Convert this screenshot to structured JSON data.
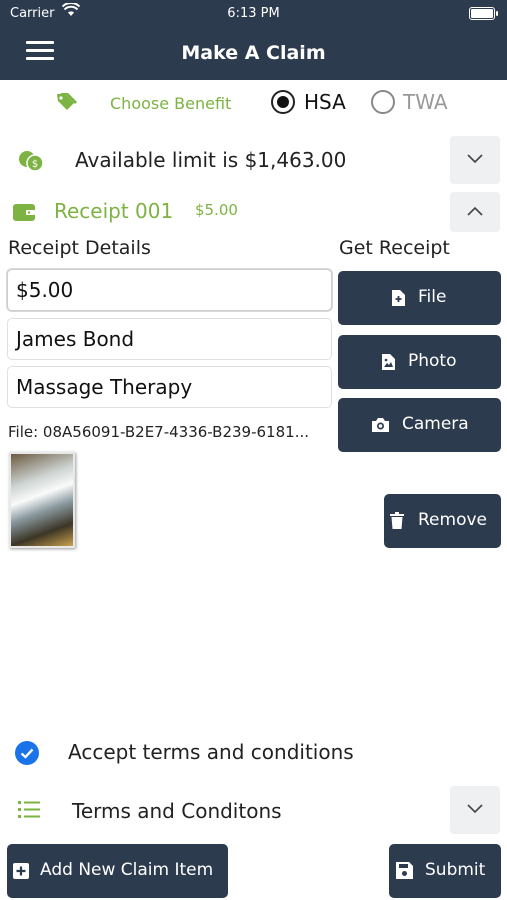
{
  "status_bar": {
    "carrier": "Carrier",
    "time": "6:13 PM"
  },
  "nav": {
    "title": "Make A Claim",
    "menu_icon": "hamburger-icon"
  },
  "benefit": {
    "label": "Choose Benefit",
    "icon": "tag-icon",
    "options": [
      {
        "label": "HSA",
        "selected": true
      },
      {
        "label": "TWA",
        "selected": false
      }
    ]
  },
  "limit": {
    "text": "Available limit is $1,463.00",
    "icon": "money-icon",
    "expanded": false
  },
  "receipt": {
    "title": "Receipt 001",
    "amount": "$5.00",
    "icon": "wallet-icon",
    "expanded": true,
    "details_label": "Receipt Details",
    "get_label": "Get Receipt",
    "fields": {
      "amount": "$5.00",
      "name": "James Bond",
      "service": "Massage Therapy"
    },
    "file_text": "File: 08A56091-B2E7-4336-B239-6181...",
    "buttons": {
      "file": "File",
      "photo": "Photo",
      "camera": "Camera",
      "remove": "Remove"
    }
  },
  "accept": {
    "text": "Accept terms and conditions",
    "checked": true
  },
  "terms": {
    "text": "Terms and Conditons",
    "icon": "list-icon"
  },
  "footer": {
    "add_label": "Add New Claim Item",
    "submit_label": "Submit"
  },
  "colors": {
    "navy": "#2d3b4e",
    "green": "#7cb342",
    "blue": "#1a73e8"
  }
}
